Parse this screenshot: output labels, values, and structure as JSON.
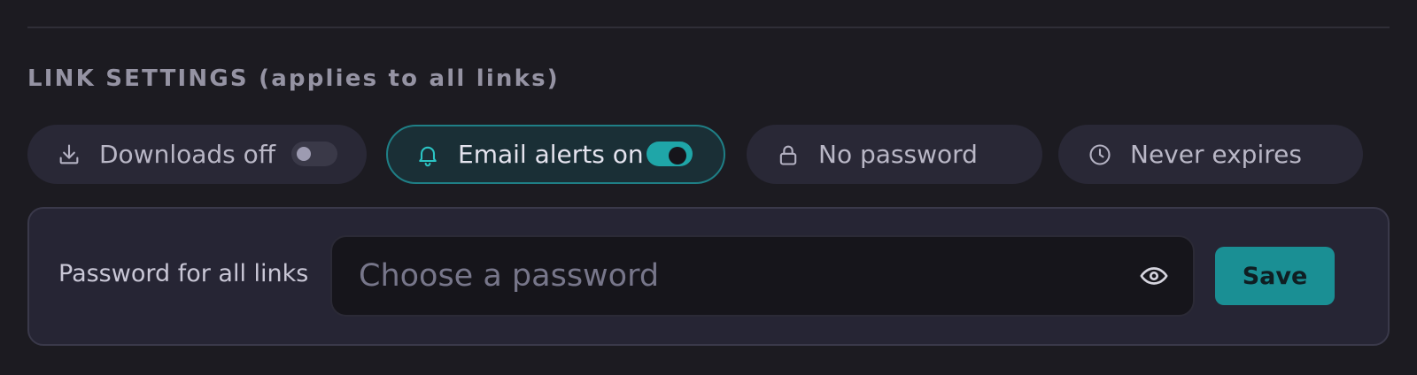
{
  "section": {
    "title": "LINK SETTINGS (applies to all links)"
  },
  "chips": {
    "downloads": {
      "label": "Downloads off",
      "icon": "download-icon",
      "enabled": false
    },
    "email_alerts": {
      "label": "Email alerts on",
      "icon": "bell-icon",
      "enabled": true
    },
    "password": {
      "label": "No password",
      "icon": "lock-icon"
    },
    "expiry": {
      "label": "Never expires",
      "icon": "clock-icon"
    }
  },
  "password_panel": {
    "label": "Password for all links",
    "input_value": "",
    "input_placeholder": "Choose a password",
    "reveal_icon": "eye-icon",
    "save_label": "Save"
  },
  "colors": {
    "background": "#1c1b21",
    "accent": "#1fa6a8",
    "chip": "#292836",
    "panel": "#262534"
  }
}
